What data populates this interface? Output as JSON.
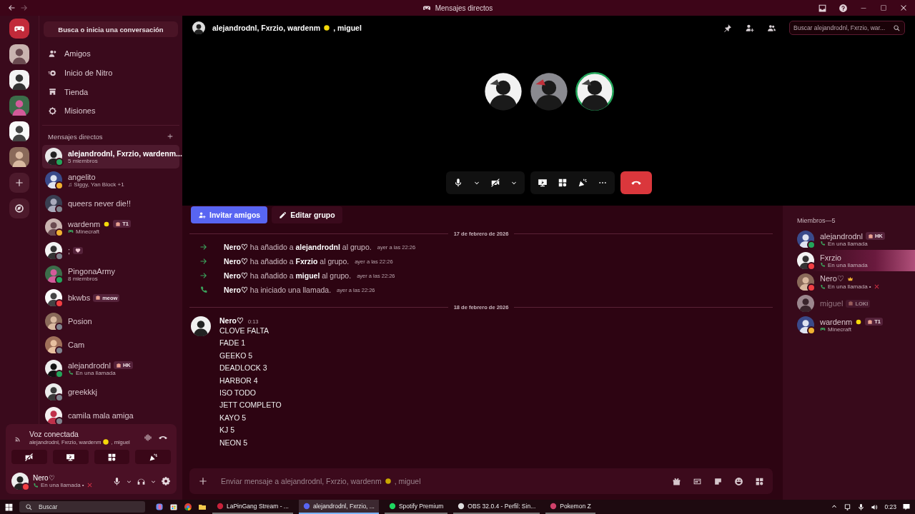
{
  "titlebar": {
    "title": "Mensajes directos"
  },
  "sidebar": {
    "search_button": "Busca o inicia una conversación",
    "nav": [
      {
        "label": "Amigos"
      },
      {
        "label": "Inicio de Nitro"
      },
      {
        "label": "Tienda"
      },
      {
        "label": "Misiones"
      }
    ],
    "dm_header": "Mensajes directos",
    "dms": [
      {
        "name": "alejandrodnl, Fxrzio, wardenm...",
        "sub": "5 miembros",
        "color": "#23a55a",
        "selected": true
      },
      {
        "name": "angelito",
        "sub": "♫ Siggy, Yan Block +1",
        "color": "#f0b232",
        "selected": false
      },
      {
        "name": "queers never die!!",
        "color": "#80848e",
        "selected": false
      },
      {
        "name": "wardenm",
        "sun": true,
        "badge": "T1",
        "sub": "Minecraft",
        "game": true,
        "color": "#f0b232",
        "selected": false
      },
      {
        "name": ";",
        "heart_pill": true,
        "color": "#80848e",
        "selected": false
      },
      {
        "name": "PingonaArmy",
        "sub": "8 miembros",
        "color": "#23a55a",
        "selected": false
      },
      {
        "name": "bkwbs",
        "badge": "meow",
        "color": "#f23f43",
        "selected": false
      },
      {
        "name": "Posion",
        "color": "#80848e",
        "selected": false
      },
      {
        "name": "Cam",
        "color": "#80848e",
        "selected": false
      },
      {
        "name": "alejandrodnl",
        "badge": "HK",
        "sub": "En una llamada",
        "call": true,
        "color": "#23a55a",
        "selected": false
      },
      {
        "name": "greekkkj",
        "color": "#80848e",
        "selected": false
      },
      {
        "name": "camila mala amiga",
        "color": "#80848e",
        "selected": false
      }
    ]
  },
  "voice_panel": {
    "title": "Voz conectada",
    "channel_before": "alejandrodnl, Fxrzio, wardenm",
    "channel_after": ", miguel"
  },
  "user_panel": {
    "name": "Nero♡",
    "status_text": "En una llamada •",
    "color": "#f23f43"
  },
  "header": {
    "title_before": "alejandrodnl, Fxrzio, wardenm",
    "title_after": ", miguel",
    "search_placeholder": "Buscar alejandrodnl, Fxrzio, war..."
  },
  "chat": {
    "buttons": [
      {
        "label": "Invitar amigos",
        "kind": "primary"
      },
      {
        "label": "Editar grupo",
        "kind": "secondary"
      }
    ],
    "sections": [
      {
        "date": "17 de febrero de 2026",
        "items": [
          {
            "kind": "add",
            "text": "**Nero♡** ha añadido a **alejandrodnl** al grupo.",
            "time": "ayer a las 22:26"
          },
          {
            "kind": "add",
            "text": "**Nero♡** ha añadido a **Fxrzio** al grupo.",
            "time": "ayer a las 22:26"
          },
          {
            "kind": "add",
            "text": "**Nero♡** ha añadido a **miguel** al grupo.",
            "time": "ayer a las 22:26"
          },
          {
            "kind": "call",
            "text": "**Nero♡** ha iniciado una llamada.",
            "time": "ayer a las 22:26"
          }
        ]
      },
      {
        "date": "18 de febrero de 2026",
        "items": [
          {
            "kind": "message",
            "author": "Nero♡",
            "time": "0:13",
            "lines": [
              "CLOVE FALTA",
              "FADE 1",
              "GEEKO 5",
              "DEADLOCK 3",
              "HARBOR 4",
              "ISO TODO",
              "JETT COMPLETO",
              "KAYO 5",
              "KJ 5",
              "NEON 5"
            ]
          }
        ]
      }
    ],
    "composer": {
      "text_before": "Enviar mensaje a alejandrodnl, Fxrzio, wardenm",
      "text_after": ", miguel"
    }
  },
  "members": {
    "title": "Miembros—5",
    "list": [
      {
        "name": "alejandrodnl",
        "badge": "HK",
        "sub": "En una llamada",
        "call": true,
        "color": "#23a55a",
        "offline": false
      },
      {
        "name": "Fxrzio",
        "sub": "En una llamada",
        "call": true,
        "color": "#f23f43",
        "offline": false,
        "banner": true
      },
      {
        "name": "Nero♡",
        "crown": true,
        "sub": "En una llamada •",
        "call": true,
        "color": "#f23f43",
        "offline": false,
        "muted_x": true
      },
      {
        "name": "miguel",
        "badge": "LOKI",
        "offline": true
      },
      {
        "name": "wardenm",
        "sun": true,
        "badge": "T1",
        "sub": "Minecraft",
        "game": true,
        "color": "#f0b232",
        "offline": false
      }
    ]
  },
  "taskbar": {
    "search": "Buscar",
    "apps": [
      {
        "label": "LaPinGang Stream - ...",
        "active": false
      },
      {
        "label": "alejandrodnl, Fxrzio, ...",
        "active": true
      },
      {
        "label": "Spotify Premium",
        "active": false
      },
      {
        "label": "OBS 32.0.4 - Perfil: Sin...",
        "active": false
      },
      {
        "label": "Pokemon Z",
        "active": false
      }
    ],
    "time": "0:23"
  }
}
